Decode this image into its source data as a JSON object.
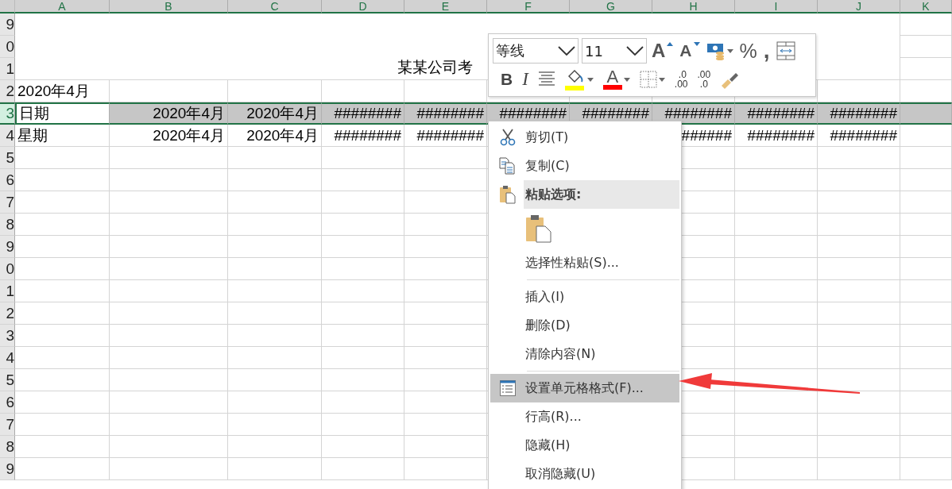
{
  "column_headers": [
    "A",
    "B",
    "C",
    "D",
    "E",
    "F",
    "G",
    "H",
    "I",
    "J",
    "K"
  ],
  "title_rows": [
    {
      "label": "9"
    },
    {
      "label": "0"
    },
    {
      "label": "1"
    }
  ],
  "title": "某某公司考",
  "rows": [
    {
      "label": "2",
      "selected": false,
      "cells": [
        "2020年4月"
      ]
    },
    {
      "label": "3",
      "selected": true,
      "cells": [
        "日期",
        "2020年4月",
        "2020年4月",
        "########",
        "########",
        "########",
        "########",
        "########",
        "########",
        "########"
      ]
    },
    {
      "label": "4",
      "selected": false,
      "cells": [
        "星期",
        "2020年4月",
        "2020年4月",
        "########",
        "########",
        null,
        null,
        "######",
        "########",
        "########"
      ]
    },
    {
      "label": "5",
      "selected": false
    },
    {
      "label": "6",
      "selected": false
    },
    {
      "label": "7",
      "selected": false
    },
    {
      "label": "8",
      "selected": false
    },
    {
      "label": "9",
      "selected": false
    },
    {
      "label": "0",
      "selected": false
    },
    {
      "label": "1",
      "selected": false
    },
    {
      "label": "2",
      "selected": false
    },
    {
      "label": "3",
      "selected": false
    },
    {
      "label": "4",
      "selected": false
    },
    {
      "label": "5",
      "selected": false
    },
    {
      "label": "6",
      "selected": false
    },
    {
      "label": "7",
      "selected": false
    },
    {
      "label": "8",
      "selected": false
    },
    {
      "label": "9",
      "selected": false
    }
  ],
  "mini_toolbar": {
    "font": "等线",
    "size": "11",
    "row_1": [
      {
        "kind": "grow",
        "label": "A",
        "dropdown": false
      },
      {
        "kind": "shrink",
        "label": "A",
        "dropdown": false
      },
      {
        "kind": "currency",
        "dropdown": true
      },
      {
        "kind": "percent",
        "label": "%",
        "dropdown": false
      },
      {
        "kind": "comma",
        "label": ",",
        "dropdown": false
      },
      {
        "kind": "wrap",
        "dropdown": false
      }
    ],
    "row_2": [
      {
        "kind": "bold",
        "label": "B",
        "dropdown": false
      },
      {
        "kind": "italic",
        "label": "I",
        "dropdown": false
      },
      {
        "kind": "align",
        "dropdown": false
      },
      {
        "kind": "fill",
        "color": "#ffff00",
        "dropdown": true
      },
      {
        "kind": "font-color",
        "label": "A",
        "color": "#ff0000",
        "dropdown": true
      },
      {
        "kind": "borders",
        "dropdown": true
      },
      {
        "kind": "increase-decimal",
        "top": ".0",
        "bottom": ".00",
        "dropdown": false
      },
      {
        "kind": "decrease-decimal",
        "top": ".00",
        "bottom": ".0",
        "dropdown": false
      },
      {
        "kind": "format-painter",
        "dropdown": false
      }
    ]
  },
  "context_menu": [
    {
      "kind": "cut",
      "label": "剪切(T)",
      "selected": false
    },
    {
      "kind": "copy",
      "label": "复制(C)",
      "selected": false
    },
    {
      "kind": "header",
      "label": "粘贴选项:"
    },
    {
      "kind": "paste-option"
    },
    {
      "kind": "item",
      "label": "选择性粘贴(S)...",
      "selected": false
    },
    {
      "kind": "separator"
    },
    {
      "kind": "item",
      "label": "插入(I)",
      "selected": false
    },
    {
      "kind": "item",
      "label": "删除(D)",
      "selected": false
    },
    {
      "kind": "item",
      "label": "清除内容(N)",
      "selected": false
    },
    {
      "kind": "separator"
    },
    {
      "kind": "format-cells",
      "label": "设置单元格格式(F)...",
      "selected": true
    },
    {
      "kind": "item",
      "label": "行高(R)...",
      "selected": false
    },
    {
      "kind": "item",
      "label": "隐藏(H)",
      "selected": false
    },
    {
      "kind": "item",
      "label": "取消隐藏(U)",
      "selected": false
    }
  ],
  "annotation": {
    "kind": "arrow"
  }
}
